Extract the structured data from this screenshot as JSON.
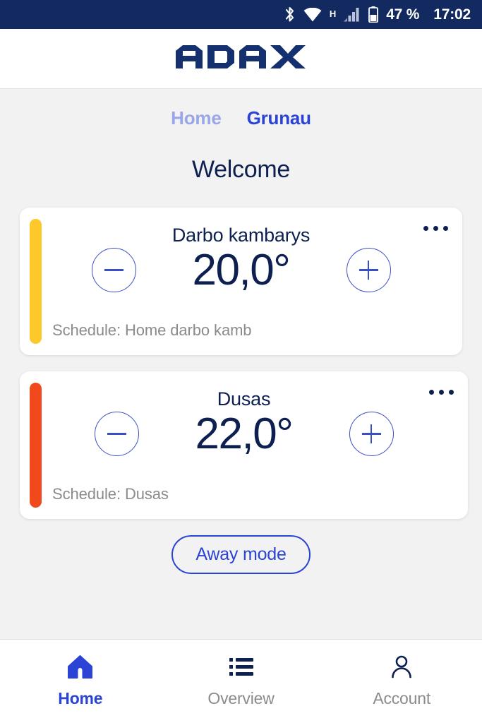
{
  "statusbar": {
    "bluetooth_icon": "bluetooth-icon",
    "wifi_icon": "wifi-icon",
    "network_type": "H",
    "signal_icon": "cellular-signal-icon",
    "battery_icon": "battery-icon",
    "battery_text": "47 %",
    "time": "17:02",
    "background_color": "#122a5f"
  },
  "appbar": {
    "logo_text": "ADAX",
    "logo_color": "#15306e"
  },
  "tabs": [
    {
      "label": "Home",
      "active": false
    },
    {
      "label": "Grunau",
      "active": true
    }
  ],
  "main": {
    "welcome_title": "Welcome",
    "away_button_label": "Away mode",
    "accent_active": "#2b44d6",
    "accent_inactive": "#9aa6e8",
    "text_navy": "#0d2050"
  },
  "devices": [
    {
      "name": "Darbo kambarys",
      "temperature": "20,0°",
      "schedule": "Schedule: Home darbo kamb",
      "accent_color": "#fdc82a",
      "decrease_label": "−",
      "increase_label": "+",
      "menu_label": "•••"
    },
    {
      "name": "Dusas",
      "temperature": "22,0°",
      "schedule": "Schedule: Dusas",
      "accent_color": "#f2491c",
      "decrease_label": "−",
      "increase_label": "+",
      "menu_label": "•••"
    }
  ],
  "bottomnav": [
    {
      "label": "Home",
      "icon": "home-icon",
      "active": true
    },
    {
      "label": "Overview",
      "icon": "list-icon",
      "active": false
    },
    {
      "label": "Account",
      "icon": "person-icon",
      "active": false
    }
  ]
}
